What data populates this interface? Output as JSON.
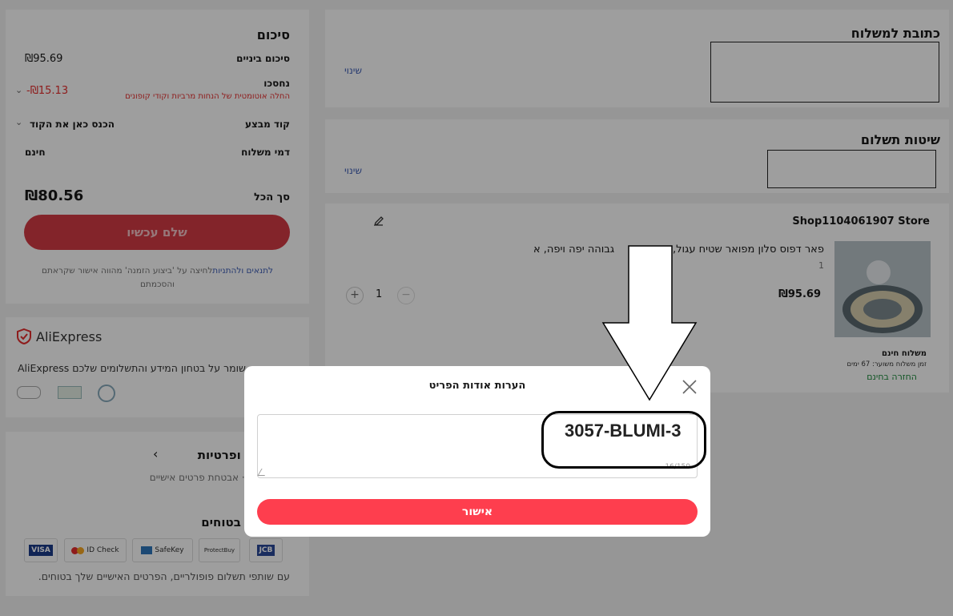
{
  "summary": {
    "title": "סיכום",
    "subtotal_label": "סיכום ביניים",
    "subtotal_value": "₪95.69",
    "saved_label": "נחסכו",
    "saved_value": "-₪15.13",
    "saved_note": "החלה אוטומטית של הנחות מרביות וקודי קופונים",
    "promo_label": "קוד מבצע",
    "promo_placeholder": "הכנס כאן את הקוד",
    "shipping_label": "דמי משלוח",
    "shipping_value": "חינם",
    "total_label": "סך הכל",
    "total_value": "₪80.56",
    "pay_button": "שלם עכשיו",
    "terms_link": "לתנאים ולהתניות",
    "terms_text": "לחיצה על 'ביצוע הזמנה' מהווה אישור שקראתם והסכמתם"
  },
  "trust": {
    "brand": "AliExpress",
    "text": "AliExpress שומר על בטחון המידע והתשלומים שלכם"
  },
  "security": {
    "title": "בטחה ופרטיות",
    "subtitle": "בטוחים · אבטחת פרטים אישיים",
    "payments_title": "לומים בטוחים",
    "logos": [
      "VISA",
      "ID Check",
      "SafeKey",
      "ProtectBuy",
      "JCB"
    ],
    "footer": "עם שותפי תשלום פופולריים, הפרטים האישיים שלך בטוחים."
  },
  "address": {
    "title": "כתובת למשלוח",
    "change": "שינוי"
  },
  "payment_methods": {
    "title": "שיטות תשלום",
    "change": "שינוי"
  },
  "store": {
    "name": "Shop1104061907 Store",
    "product_title": "פאר דפוס סלון מפואר שטיח עגול, א",
    "product_title_end": "גבוהה יפה ויפה, א",
    "variant": "1",
    "price": "₪95.69",
    "quantity": "1",
    "shipping_free": "משלוח חינם",
    "delivery_time": "זמן משלוח משוער: 67 ימים",
    "free_return": "החזרה בחינם"
  },
  "modal": {
    "title": "הערות אודות הפריט",
    "note_value": "3057-BLUMI-3",
    "char_count": "16/150",
    "confirm": "אישור"
  }
}
